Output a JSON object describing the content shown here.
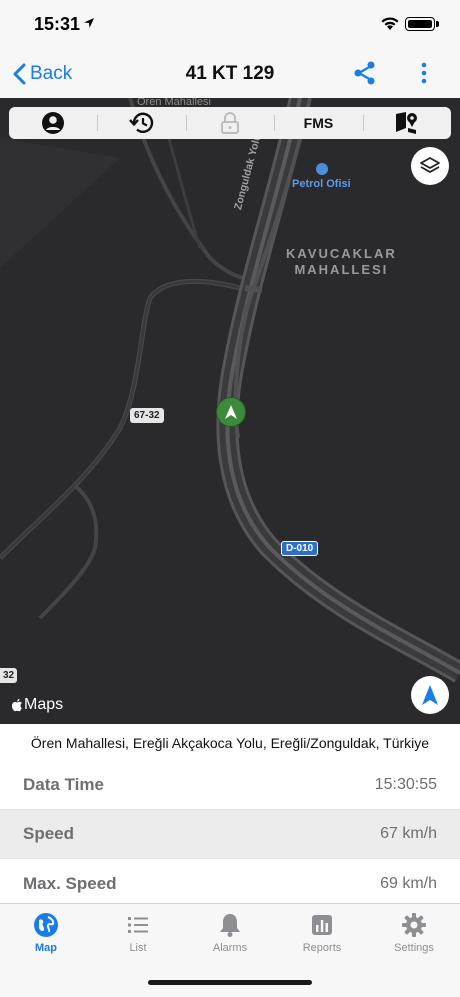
{
  "status_bar": {
    "time": "15:31"
  },
  "nav": {
    "back_label": "Back",
    "title": "41 KT 129"
  },
  "toolbar": {
    "fms_label": "FMS",
    "icons": [
      "driver-icon",
      "history-icon",
      "lock-icon",
      "fms",
      "geofence-icon"
    ]
  },
  "map": {
    "district_top": "KAVUCAKLAR",
    "district_bottom": "MAHALLESI",
    "top_label": "Ören Mahallesi",
    "road_name": "Zonguldak Yolu",
    "poi": "Petrol Ofisi",
    "shield_67": "67-32",
    "shield_d010": "D-010",
    "shield_edge": "32",
    "attribution": "Maps",
    "colors": {
      "vehicle": "#3d8a3d",
      "accent": "#1a7ce6"
    }
  },
  "address": "Ören Mahallesi, Ereğli Akçakoca Yolu, Ereğli/Zonguldak, Türkiye",
  "info": [
    {
      "label": "Data Time",
      "value": "15:30:55"
    },
    {
      "label": "Speed",
      "value": "67 km/h"
    },
    {
      "label": "Max. Speed",
      "value": "69 km/h"
    }
  ],
  "tabs": [
    {
      "label": "Map",
      "icon": "globe-icon",
      "active": true
    },
    {
      "label": "List",
      "icon": "list-icon"
    },
    {
      "label": "Alarms",
      "icon": "bell-icon"
    },
    {
      "label": "Reports",
      "icon": "chart-icon"
    },
    {
      "label": "Settings",
      "icon": "gear-icon"
    }
  ]
}
